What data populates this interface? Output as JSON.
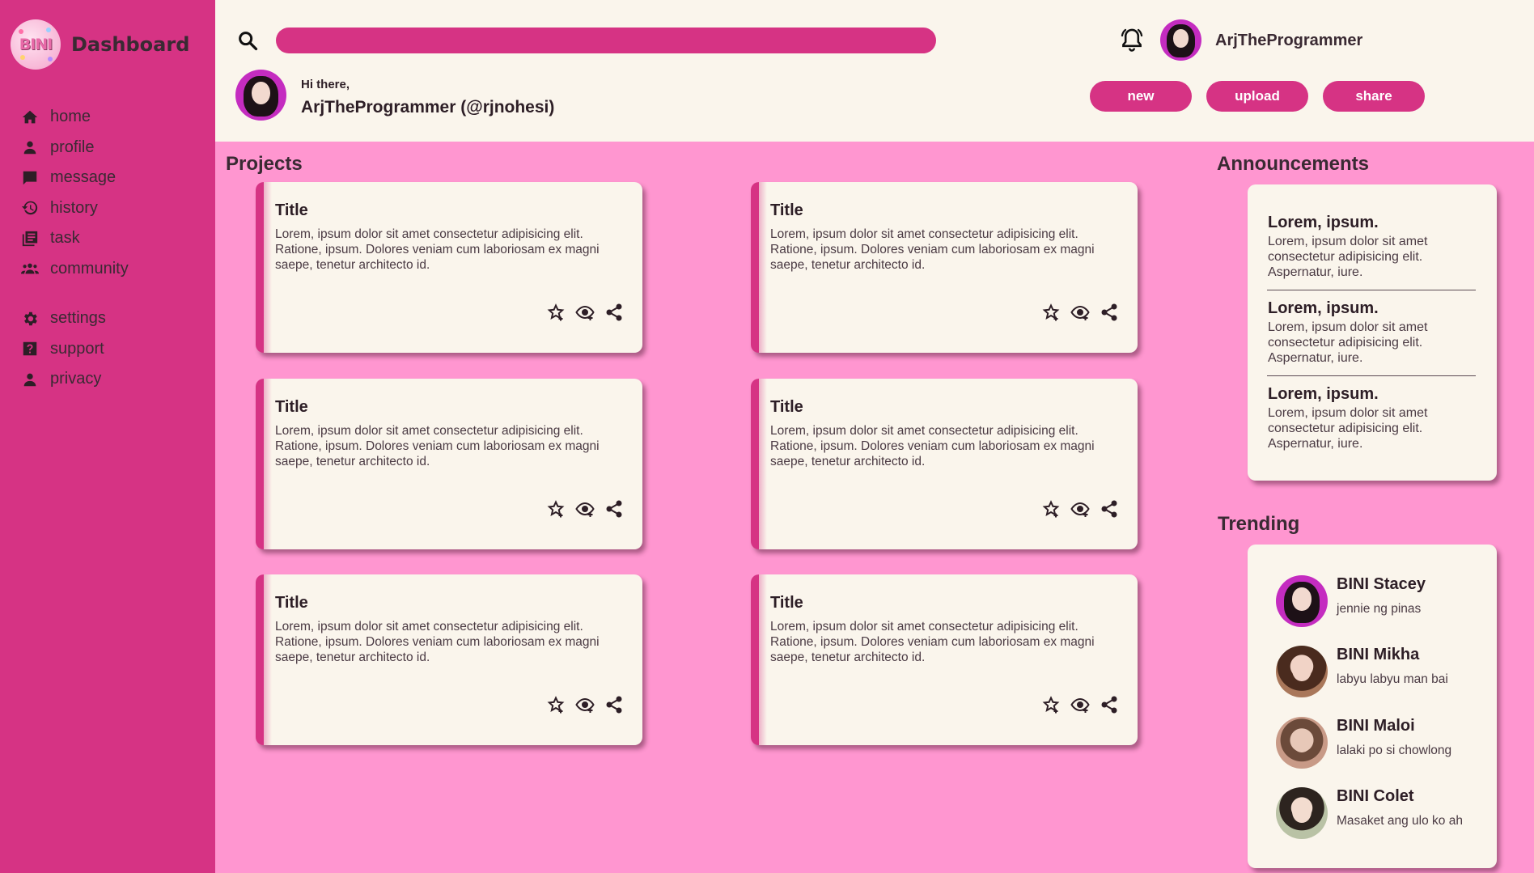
{
  "brand": {
    "logo_text": "BINI",
    "title": "Dashboard"
  },
  "sidebar": {
    "items": [
      {
        "label": "home",
        "icon": "home-icon"
      },
      {
        "label": "profile",
        "icon": "person-icon"
      },
      {
        "label": "message",
        "icon": "chat-icon"
      },
      {
        "label": "history",
        "icon": "history-icon"
      },
      {
        "label": "task",
        "icon": "task-icon"
      },
      {
        "label": "community",
        "icon": "group-icon"
      }
    ],
    "secondary": [
      {
        "label": "settings",
        "icon": "gear-icon"
      },
      {
        "label": "support",
        "icon": "help-icon"
      },
      {
        "label": "privacy",
        "icon": "person-icon"
      }
    ]
  },
  "header": {
    "search": {
      "value": "",
      "placeholder": ""
    },
    "username": "ArjTheProgrammer",
    "greeting": "Hi there,",
    "handle": "ArjTheProgrammer (@rjnohesi)",
    "buttons": {
      "new": "new",
      "upload": "upload",
      "share": "share"
    }
  },
  "projects": {
    "heading": "Projects",
    "cards": [
      {
        "title": "Title",
        "body": "Lorem, ipsum dolor sit amet consectetur adipisicing elit. Ratione, ipsum. Dolores veniam cum laboriosam ex magni saepe, tenetur architecto id."
      },
      {
        "title": "Title",
        "body": "Lorem, ipsum dolor sit amet consectetur adipisicing elit. Ratione, ipsum. Dolores veniam cum laboriosam ex magni saepe, tenetur architecto id."
      },
      {
        "title": "Title",
        "body": "Lorem, ipsum dolor sit amet consectetur adipisicing elit. Ratione, ipsum. Dolores veniam cum laboriosam ex magni saepe, tenetur architecto id."
      },
      {
        "title": "Title",
        "body": "Lorem, ipsum dolor sit amet consectetur adipisicing elit. Ratione, ipsum. Dolores veniam cum laboriosam ex magni saepe, tenetur architecto id."
      },
      {
        "title": "Title",
        "body": "Lorem, ipsum dolor sit amet consectetur adipisicing elit. Ratione, ipsum. Dolores veniam cum laboriosam ex magni saepe, tenetur architecto id."
      },
      {
        "title": "Title",
        "body": "Lorem, ipsum dolor sit amet consectetur adipisicing elit. Ratione, ipsum. Dolores veniam cum laboriosam ex magni saepe, tenetur architecto id."
      }
    ]
  },
  "announcements": {
    "heading": "Announcements",
    "items": [
      {
        "title": "Lorem, ipsum.",
        "body": "Lorem, ipsum dolor sit amet consectetur adipisicing elit. Aspernatur, iure."
      },
      {
        "title": "Lorem, ipsum.",
        "body": "Lorem, ipsum dolor sit amet consectetur adipisicing elit. Aspernatur, iure."
      },
      {
        "title": "Lorem, ipsum.",
        "body": "Lorem, ipsum dolor sit amet consectetur adipisicing elit. Aspernatur, iure."
      }
    ]
  },
  "trending": {
    "heading": "Trending",
    "items": [
      {
        "name": "BINI Stacey",
        "subtitle": "jennie ng pinas"
      },
      {
        "name": "BINI Mikha",
        "subtitle": "labyu labyu man bai"
      },
      {
        "name": "BINI Maloi",
        "subtitle": "lalaki po si chowlong"
      },
      {
        "name": "BINI Colet",
        "subtitle": "Masaket ang ulo ko ah"
      }
    ]
  },
  "colors": {
    "sidebar": "#d63384",
    "background": "#ff96d0",
    "panel": "#faf5ec",
    "accent": "#d63384",
    "text": "#3a2a33"
  }
}
